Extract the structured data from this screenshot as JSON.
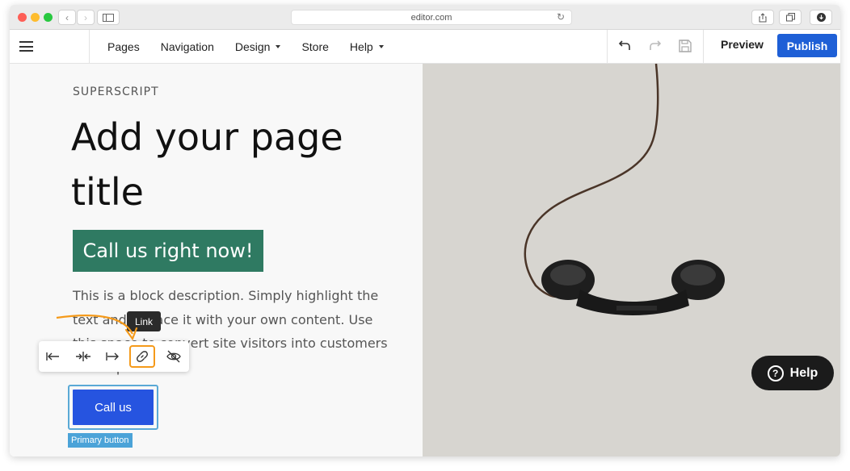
{
  "browser": {
    "url": "editor.com",
    "colors": {
      "close": "#fe5f57",
      "minimize": "#febc2e",
      "zoom": "#28c840"
    }
  },
  "toolbar": {
    "nav_items": [
      {
        "label": "Pages"
      },
      {
        "label": "Navigation"
      },
      {
        "label": "Design"
      },
      {
        "label": "Store"
      },
      {
        "label": "Help"
      }
    ],
    "preview_label": "Preview",
    "publish_label": "Publish"
  },
  "page": {
    "superscript": "SUPERSCRIPT",
    "title": "Add your page title",
    "cta_label": "Call us right now!",
    "description": "This is a block description. Simply highlight the text and replace it with your own content. Use this space to convert site visitors into customers with a promotion"
  },
  "format_bar": {
    "tooltip": "Link",
    "buttons": [
      "align-left-icon",
      "align-center-icon",
      "align-right-icon",
      "link-icon",
      "hide-icon"
    ]
  },
  "selected_button": {
    "label": "Call us",
    "tag": "Primary button"
  },
  "help_button": {
    "label": "Help"
  },
  "colors": {
    "publish": "#1e5fd6",
    "cta": "#2f7a62",
    "primary_button": "#2654e0",
    "highlight": "#f59a1a"
  }
}
